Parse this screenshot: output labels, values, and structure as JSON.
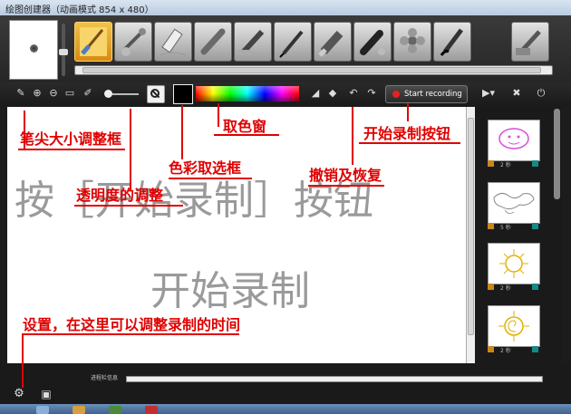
{
  "window": {
    "title": "绘图创建器（动画模式 854 x 480）"
  },
  "toolbar": {
    "brushes": [
      "paint-brush",
      "airbrush",
      "eraser",
      "chalk",
      "marker",
      "pencil",
      "highlighter",
      "smudge",
      "stamp",
      "calligraphy",
      "roller"
    ],
    "record_label": "Start recording",
    "colors": {
      "accent": "#e00000",
      "record_dot": "#e82020",
      "current_color": "#000000"
    }
  },
  "frames": [
    {
      "time": "2 秒",
      "drawing": "face"
    },
    {
      "time": "5 秒",
      "drawing": "map"
    },
    {
      "time": "2 秒",
      "drawing": "sun"
    },
    {
      "time": "2 秒",
      "drawing": "sun-swirl"
    }
  ],
  "progress": {
    "label": "进程栏信息"
  },
  "annotations": {
    "brush_size": "笔尖大小调整框",
    "color_picker_window": "取色窗",
    "start_record_button": "开始录制按钮",
    "opacity": "透明度的调整",
    "color_select_box": "色彩取选框",
    "undo_redo": "撤销及恢复",
    "settings": "设置，在这里可以调整录制的时间"
  },
  "overlay": {
    "line1": "按［开始录制］按钮",
    "line2": "开始录制"
  }
}
